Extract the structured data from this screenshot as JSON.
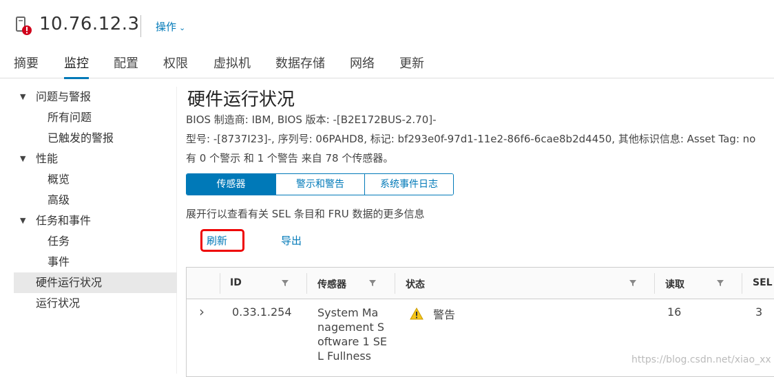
{
  "header": {
    "host_title": "10.76.12.3",
    "actions_label": "操作",
    "host_icon": "host-alert-icon"
  },
  "tabs": [
    {
      "label": "摘要"
    },
    {
      "label": "监控"
    },
    {
      "label": "配置"
    },
    {
      "label": "权限"
    },
    {
      "label": "虚拟机"
    },
    {
      "label": "数据存储"
    },
    {
      "label": "网络"
    },
    {
      "label": "更新"
    }
  ],
  "active_tab": "监控",
  "sidebar": {
    "items": [
      {
        "label": "问题与警报"
      },
      {
        "label": "所有问题"
      },
      {
        "label": "已触发的警报"
      },
      {
        "label": "性能"
      },
      {
        "label": "概览"
      },
      {
        "label": "高级"
      },
      {
        "label": "任务和事件"
      },
      {
        "label": "任务"
      },
      {
        "label": "事件"
      },
      {
        "label": "硬件运行状况"
      },
      {
        "label": "运行状况"
      }
    ],
    "selected": "硬件运行状况"
  },
  "main": {
    "title": "硬件运行状况",
    "bios_line": "BIOS 制造商: IBM, BIOS 版本: -[B2E172BUS-2.70]-",
    "model_line": "型号: -[8737I23]-, 序列号: 06PAHD8, 标记: bf293e0f-97d1-11e2-86f6-6cae8b2d4450, 其他标识信息: Asset Tag: no",
    "summary_line": "有 0 个警示 和 1 个警告 来自 78 个传感器。",
    "segments": [
      {
        "label": "传感器"
      },
      {
        "label": "警示和警告"
      },
      {
        "label": "系统事件日志"
      }
    ],
    "active_segment": "传感器",
    "hint": "展开行以查看有关 SEL 条目和 FRU 数据的更多信息",
    "refresh_label": "刷新",
    "export_label": "导出"
  },
  "table": {
    "columns": [
      "ID",
      "传感器",
      "状态",
      "读取",
      "SEL"
    ],
    "rows": [
      {
        "id": "0.33.1.254",
        "sensor_lines": [
          "System Ma",
          "nagement S",
          "oftware 1 SE",
          "L Fullness"
        ],
        "status": "警告",
        "status_icon": "warning-icon",
        "reading": "16",
        "sel": "3"
      }
    ]
  },
  "watermark": "https://blog.csdn.net/xiao_xx",
  "colors": {
    "accent": "#0079b8",
    "warning": "#f5c518",
    "highlight_box": "#e00000"
  }
}
